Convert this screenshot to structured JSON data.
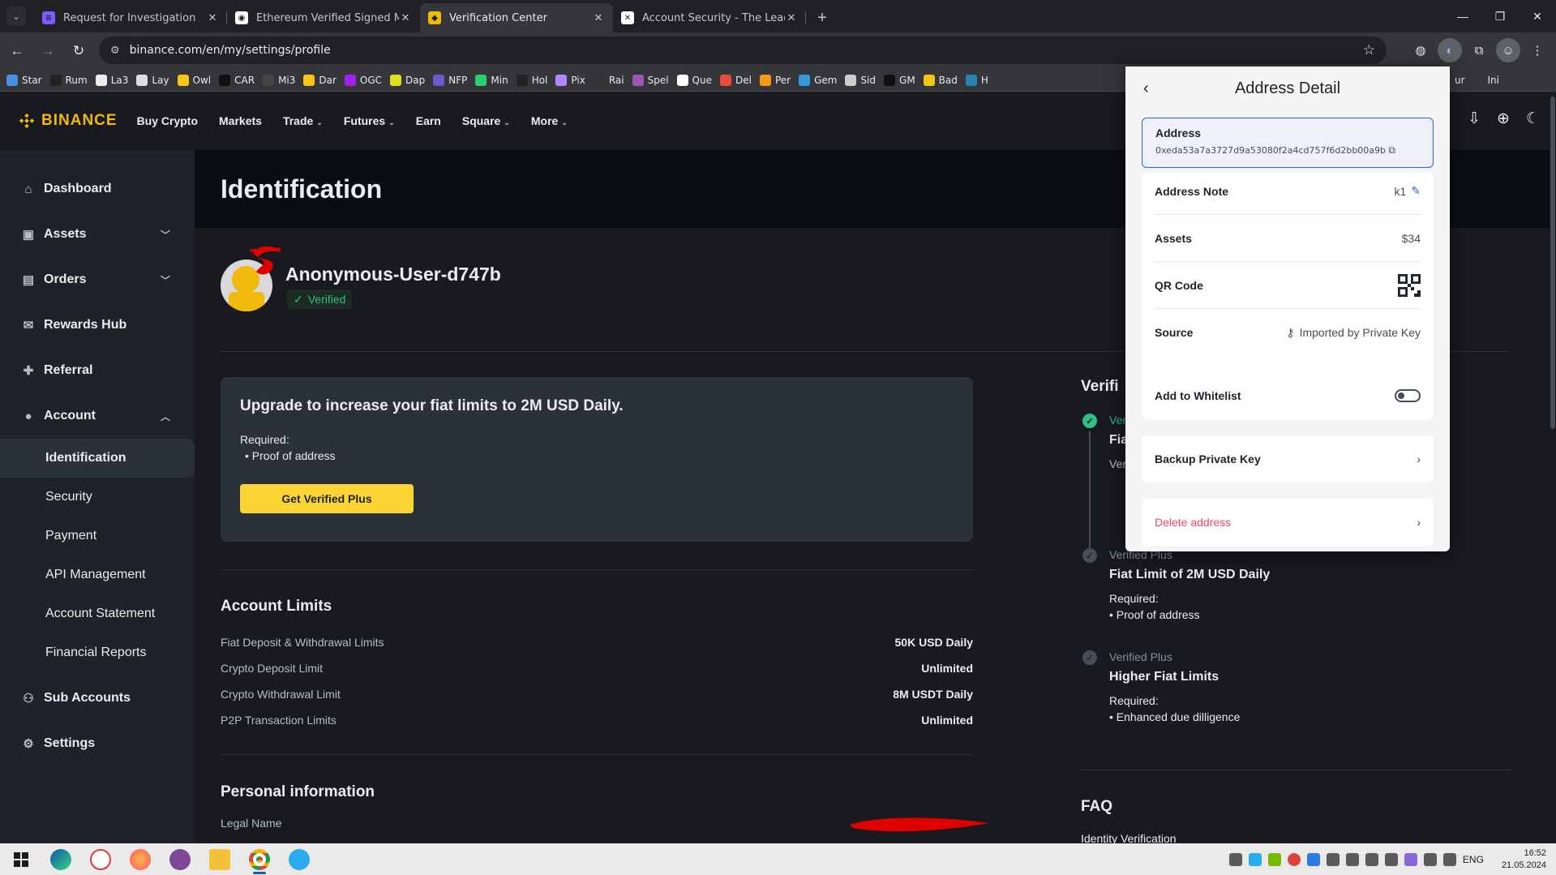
{
  "browser": {
    "tabs": [
      {
        "title": "Request for Investigation",
        "fav_color": "#7c5cff",
        "fav_glyph": "≡"
      },
      {
        "title": "Ethereum Verified Signed Mess",
        "fav_color": "#ffffff",
        "fav_glyph": "◉"
      },
      {
        "title": "Verification Center",
        "fav_color": "#f0b90b",
        "fav_glyph": "◆"
      },
      {
        "title": "Account Security - The Leading",
        "fav_color": "#ffffff",
        "fav_glyph": "✕"
      }
    ],
    "url": "binance.com/en/my/settings/profile",
    "bookmarks": [
      {
        "label": "Star",
        "color": "#4a90e2"
      },
      {
        "label": "Rum",
        "color": "#222"
      },
      {
        "label": "La3",
        "color": "#eee"
      },
      {
        "label": "Lay",
        "color": "#ddd"
      },
      {
        "label": "Owl",
        "color": "#f5c518"
      },
      {
        "label": "CAR",
        "color": "#111"
      },
      {
        "label": "Mi3",
        "color": "#444"
      },
      {
        "label": "Dar",
        "color": "#f5c518"
      },
      {
        "label": "OGC",
        "color": "#a020f0"
      },
      {
        "label": "Dap",
        "color": "#e0e020"
      },
      {
        "label": "NFP",
        "color": "#6a5acd"
      },
      {
        "label": "Min",
        "color": "#2ecc71"
      },
      {
        "label": "Hol",
        "color": "#222"
      },
      {
        "label": "Pix",
        "color": "#b388ff"
      },
      {
        "label": "Rai",
        "color": "#333"
      },
      {
        "label": "Spel",
        "color": "#9b59b6"
      },
      {
        "label": "Que",
        "color": "#fff"
      },
      {
        "label": "Del",
        "color": "#e74c3c"
      },
      {
        "label": "Per",
        "color": "#f39c12"
      },
      {
        "label": "Gem",
        "color": "#3498db"
      },
      {
        "label": "Sid",
        "color": "#ccc"
      },
      {
        "label": "GM",
        "color": "#111"
      },
      {
        "label": "Bad",
        "color": "#f1c40f"
      },
      {
        "label": "H",
        "color": "#2980b9"
      }
    ],
    "bookmarks_tail": [
      "ur",
      "Ini"
    ]
  },
  "header": {
    "brand": "BINANCE",
    "nav": [
      {
        "label": "Buy Crypto",
        "dropdown": false
      },
      {
        "label": "Markets",
        "dropdown": false
      },
      {
        "label": "Trade",
        "dropdown": true
      },
      {
        "label": "Futures",
        "dropdown": true
      },
      {
        "label": "Earn",
        "dropdown": false
      },
      {
        "label": "Square",
        "dropdown": true
      },
      {
        "label": "More",
        "dropdown": true
      }
    ]
  },
  "sidebar": {
    "items": [
      {
        "label": "Dashboard",
        "icon": "home-icon",
        "glyph": "⌂"
      },
      {
        "label": "Assets",
        "icon": "wallet-icon",
        "glyph": "▣",
        "arrow": "▼"
      },
      {
        "label": "Orders",
        "icon": "orders-icon",
        "glyph": "▤",
        "arrow": "▼"
      },
      {
        "label": "Rewards Hub",
        "icon": "rewards-icon",
        "glyph": "✉"
      },
      {
        "label": "Referral",
        "icon": "referral-icon",
        "glyph": "✚"
      },
      {
        "label": "Account",
        "icon": "account-icon",
        "glyph": "●",
        "arrow": "▲"
      }
    ],
    "account_sub": [
      "Identification",
      "Security",
      "Payment",
      "API Management",
      "Account Statement",
      "Financial Reports"
    ],
    "bottom_items": [
      {
        "label": "Sub Accounts",
        "icon": "sub-accounts-icon",
        "glyph": "⚇"
      },
      {
        "label": "Settings",
        "icon": "settings-icon",
        "glyph": "⚙"
      }
    ]
  },
  "page": {
    "title": "Identification",
    "username": "Anonymous-User-d747b",
    "verified_label": "Verified",
    "upgrade": {
      "title": "Upgrade to increase your fiat limits to 2M USD Daily.",
      "required_label": "Required:",
      "requirement": "Proof of address",
      "button": "Get Verified Plus"
    },
    "limits_title": "Account Limits",
    "limits": [
      {
        "label": "Fiat Deposit & Withdrawal Limits",
        "value": "50K USD Daily"
      },
      {
        "label": "Crypto Deposit Limit",
        "value": "Unlimited"
      },
      {
        "label": "Crypto Withdrawal Limit",
        "value": "8M USDT Daily"
      },
      {
        "label": "P2P Transaction Limits",
        "value": "Unlimited"
      }
    ],
    "personal_title": "Personal information",
    "legal_name_label": "Legal Name"
  },
  "verification": {
    "title": "Verifi",
    "step1": {
      "label": "Ver",
      "title": "Fia",
      "sub": "Ver"
    },
    "step2": {
      "label": "Verified Plus",
      "title": "Fiat Limit of 2M USD Daily",
      "required_label": "Required:",
      "requirement": "Proof of address"
    },
    "step3": {
      "label": "Verified Plus",
      "title": "Higher Fiat Limits",
      "required_label": "Required:",
      "requirement": "Enhanced due dilligence"
    },
    "faq_title": "FAQ",
    "faq_first": "Identity Verification"
  },
  "popup": {
    "title": "Address Detail",
    "address_label": "Address",
    "address_value": "0xeda53a7a3727d9a53080f2a4cd757f6d2bb00a9b",
    "note_label": "Address Note",
    "note_value": "k1",
    "assets_label": "Assets",
    "assets_value": "$34",
    "qr_label": "QR Code",
    "source_label": "Source",
    "source_value": "Imported by Private Key",
    "whitelist_label": "Add to Whitelist",
    "whitelist_on": false,
    "backup_label": "Backup Private Key",
    "delete_label": "Delete address"
  },
  "taskbar": {
    "lang": "ENG",
    "time": "16:52",
    "date": "21.05.2024"
  },
  "colors": {
    "accent": "#f0b90b",
    "button": "#fcd535",
    "success": "#2ebd85",
    "danger": "#f6465d",
    "popup_focus": "#3b5bdb"
  }
}
